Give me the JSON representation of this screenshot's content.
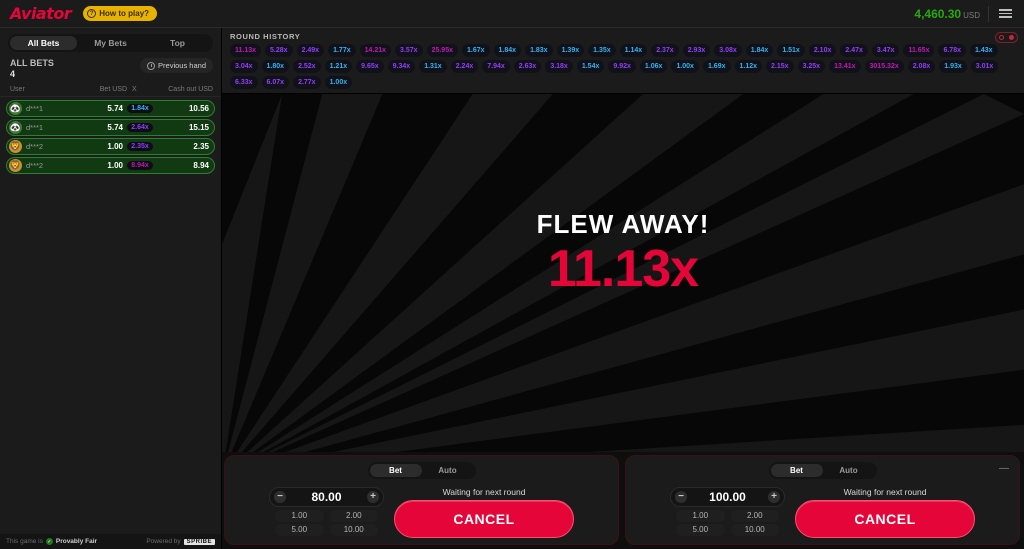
{
  "header": {
    "logo": "Aviator",
    "how_to_play": "How to play?",
    "how_to_play_icon": "question-circle-icon",
    "balance": "4,460.30",
    "currency": "USD",
    "menu_icon": "hamburger-menu-icon"
  },
  "sidebar": {
    "tabs": [
      {
        "label": "All Bets",
        "active": true
      },
      {
        "label": "My Bets",
        "active": false
      },
      {
        "label": "Top",
        "active": false
      }
    ],
    "all_bets_label": "ALL BETS",
    "all_bets_count": "4",
    "previous_hand": "Previous hand",
    "previous_hand_icon": "history-clock-icon",
    "columns": [
      "User",
      "Bet USD",
      "X",
      "Cash out USD"
    ],
    "rows": [
      {
        "user": "d***1",
        "bet": "5.74",
        "multiplier": "1.84x",
        "cashout": "10.56",
        "avatar": "panda-avatar",
        "mult_color": "#34b3f1"
      },
      {
        "user": "d***1",
        "bet": "5.74",
        "multiplier": "2.64x",
        "cashout": "15.15",
        "avatar": "panda-avatar",
        "mult_color": "#913ef8"
      },
      {
        "user": "d***2",
        "bet": "1.00",
        "multiplier": "2.35x",
        "cashout": "2.35",
        "avatar": "lion-avatar",
        "mult_color": "#913ef8"
      },
      {
        "user": "d***2",
        "bet": "1.00",
        "multiplier": "8.94x",
        "cashout": "8.94",
        "avatar": "lion-avatar",
        "mult_color": "#c017b4"
      }
    ],
    "footer": {
      "text_prefix": "This game is",
      "fair_label": "Provably Fair",
      "fair_icon": "green-check-icon",
      "powered_by": "Powered by",
      "provider": "SPRIBE"
    }
  },
  "history": {
    "title": "ROUND HISTORY",
    "toggle_icon": "history-expand-toggle-icon",
    "chips": [
      {
        "value": "11.13x",
        "color": "#c017b4"
      },
      {
        "value": "5.28x",
        "color": "#913ef8"
      },
      {
        "value": "2.49x",
        "color": "#913ef8"
      },
      {
        "value": "1.77x",
        "color": "#34b3f1"
      },
      {
        "value": "14.21x",
        "color": "#c017b4"
      },
      {
        "value": "3.57x",
        "color": "#913ef8"
      },
      {
        "value": "25.95x",
        "color": "#c017b4"
      },
      {
        "value": "1.67x",
        "color": "#34b3f1"
      },
      {
        "value": "1.84x",
        "color": "#34b3f1"
      },
      {
        "value": "1.83x",
        "color": "#34b3f1"
      },
      {
        "value": "1.39x",
        "color": "#34b3f1"
      },
      {
        "value": "1.35x",
        "color": "#34b3f1"
      },
      {
        "value": "1.14x",
        "color": "#34b3f1"
      },
      {
        "value": "2.37x",
        "color": "#913ef8"
      },
      {
        "value": "2.93x",
        "color": "#913ef8"
      },
      {
        "value": "3.08x",
        "color": "#913ef8"
      },
      {
        "value": "1.84x",
        "color": "#34b3f1"
      },
      {
        "value": "1.51x",
        "color": "#34b3f1"
      },
      {
        "value": "2.10x",
        "color": "#913ef8"
      },
      {
        "value": "2.47x",
        "color": "#913ef8"
      },
      {
        "value": "3.47x",
        "color": "#913ef8"
      },
      {
        "value": "11.65x",
        "color": "#c017b4"
      },
      {
        "value": "6.78x",
        "color": "#913ef8"
      },
      {
        "value": "1.43x",
        "color": "#34b3f1"
      },
      {
        "value": "3.04x",
        "color": "#913ef8"
      },
      {
        "value": "1.80x",
        "color": "#34b3f1"
      },
      {
        "value": "2.52x",
        "color": "#913ef8"
      },
      {
        "value": "1.21x",
        "color": "#34b3f1"
      },
      {
        "value": "9.65x",
        "color": "#913ef8"
      },
      {
        "value": "9.34x",
        "color": "#913ef8"
      },
      {
        "value": "1.31x",
        "color": "#34b3f1"
      },
      {
        "value": "2.24x",
        "color": "#913ef8"
      },
      {
        "value": "7.94x",
        "color": "#913ef8"
      },
      {
        "value": "2.63x",
        "color": "#913ef8"
      },
      {
        "value": "3.18x",
        "color": "#913ef8"
      },
      {
        "value": "1.54x",
        "color": "#34b3f1"
      },
      {
        "value": "9.92x",
        "color": "#913ef8"
      },
      {
        "value": "1.06x",
        "color": "#34b3f1"
      },
      {
        "value": "1.00x",
        "color": "#34b3f1"
      },
      {
        "value": "1.69x",
        "color": "#34b3f1"
      },
      {
        "value": "1.12x",
        "color": "#34b3f1"
      },
      {
        "value": "2.15x",
        "color": "#913ef8"
      },
      {
        "value": "3.25x",
        "color": "#913ef8"
      },
      {
        "value": "13.41x",
        "color": "#c017b4"
      },
      {
        "value": "3015.32x",
        "color": "#c017b4"
      },
      {
        "value": "2.08x",
        "color": "#913ef8"
      },
      {
        "value": "1.93x",
        "color": "#34b3f1"
      },
      {
        "value": "3.01x",
        "color": "#913ef8"
      },
      {
        "value": "6.33x",
        "color": "#913ef8"
      },
      {
        "value": "6.07x",
        "color": "#913ef8"
      },
      {
        "value": "2.77x",
        "color": "#913ef8"
      },
      {
        "value": "1.00x",
        "color": "#34b3f1"
      }
    ]
  },
  "game": {
    "status_text": "FLEW AWAY!",
    "multiplier": "11.13x",
    "multiplier_color": "#e50539"
  },
  "bet_panels": [
    {
      "tabs": [
        {
          "label": "Bet",
          "active": true
        },
        {
          "label": "Auto",
          "active": false
        }
      ],
      "stake": "80.00",
      "decrement_icon": "minus-circle-icon",
      "increment_icon": "plus-circle-icon",
      "quick_amounts": [
        "1.00",
        "2.00",
        "5.00",
        "10.00"
      ],
      "status": "Waiting for next round",
      "action_label": "CANCEL",
      "show_menu": false
    },
    {
      "tabs": [
        {
          "label": "Bet",
          "active": true
        },
        {
          "label": "Auto",
          "active": false
        }
      ],
      "stake": "100.00",
      "decrement_icon": "minus-circle-icon",
      "increment_icon": "plus-circle-icon",
      "quick_amounts": [
        "1.00",
        "2.00",
        "5.00",
        "10.00"
      ],
      "status": "Waiting for next round",
      "action_label": "CANCEL",
      "menu_icon": "more-options-icon",
      "show_menu": true
    }
  ]
}
